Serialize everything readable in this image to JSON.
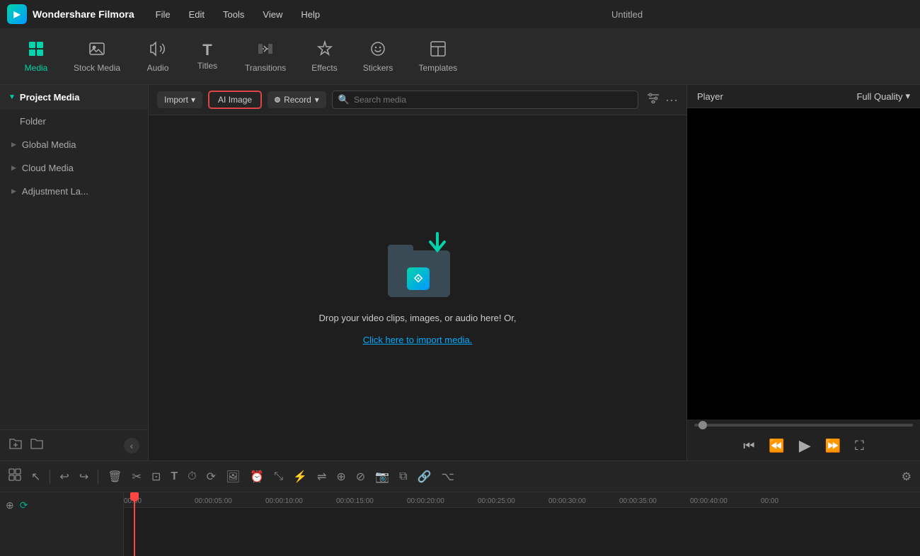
{
  "app": {
    "name": "Wondershare Filmora",
    "title": "Untitled"
  },
  "menubar": {
    "items": [
      "File",
      "Edit",
      "Tools",
      "View",
      "Help"
    ]
  },
  "toolbar": {
    "items": [
      {
        "id": "media",
        "label": "Media",
        "icon": "⊞",
        "active": true
      },
      {
        "id": "stock_media",
        "label": "Stock Media",
        "icon": "🎬"
      },
      {
        "id": "audio",
        "label": "Audio",
        "icon": "♪"
      },
      {
        "id": "titles",
        "label": "Titles",
        "icon": "T"
      },
      {
        "id": "transitions",
        "label": "Transitions",
        "icon": "⟷"
      },
      {
        "id": "effects",
        "label": "Effects",
        "icon": "✦"
      },
      {
        "id": "stickers",
        "label": "Stickers",
        "icon": "❋"
      },
      {
        "id": "templates",
        "label": "Templates",
        "icon": "⊡"
      }
    ]
  },
  "sidebar": {
    "title": "Project Media",
    "items": [
      {
        "id": "folder",
        "label": "Folder",
        "indent": true
      },
      {
        "id": "global_media",
        "label": "Global Media"
      },
      {
        "id": "cloud_media",
        "label": "Cloud Media"
      },
      {
        "id": "adjustment_layer",
        "label": "Adjustment La..."
      }
    ]
  },
  "media_toolbar": {
    "import_label": "Import",
    "ai_image_label": "AI Image",
    "record_label": "Record",
    "search_placeholder": "Search media",
    "filter_icon": "filter-icon",
    "more_icon": "more-icon"
  },
  "drop_area": {
    "main_text": "Drop your video clips, images, or audio here! Or,",
    "link_text": "Click here to import media."
  },
  "player": {
    "label": "Player",
    "quality": "Full Quality"
  },
  "timeline_toolbar": {
    "buttons": [
      "grid",
      "cursor",
      "undo",
      "redo",
      "delete",
      "cut",
      "crop",
      "text",
      "timer",
      "speed",
      "image",
      "clock",
      "fullscreen",
      "zap",
      "eq",
      "merge",
      "detach",
      "camera",
      "link",
      "split",
      "settings"
    ]
  },
  "timeline": {
    "timestamps": [
      "00:00",
      "00:00:05:00",
      "00:00:10:00",
      "00:00:15:00",
      "00:00:20:00",
      "00:00:25:00",
      "00:00:30:00",
      "00:00:35:00",
      "00:00:40:00",
      "00:00"
    ]
  }
}
